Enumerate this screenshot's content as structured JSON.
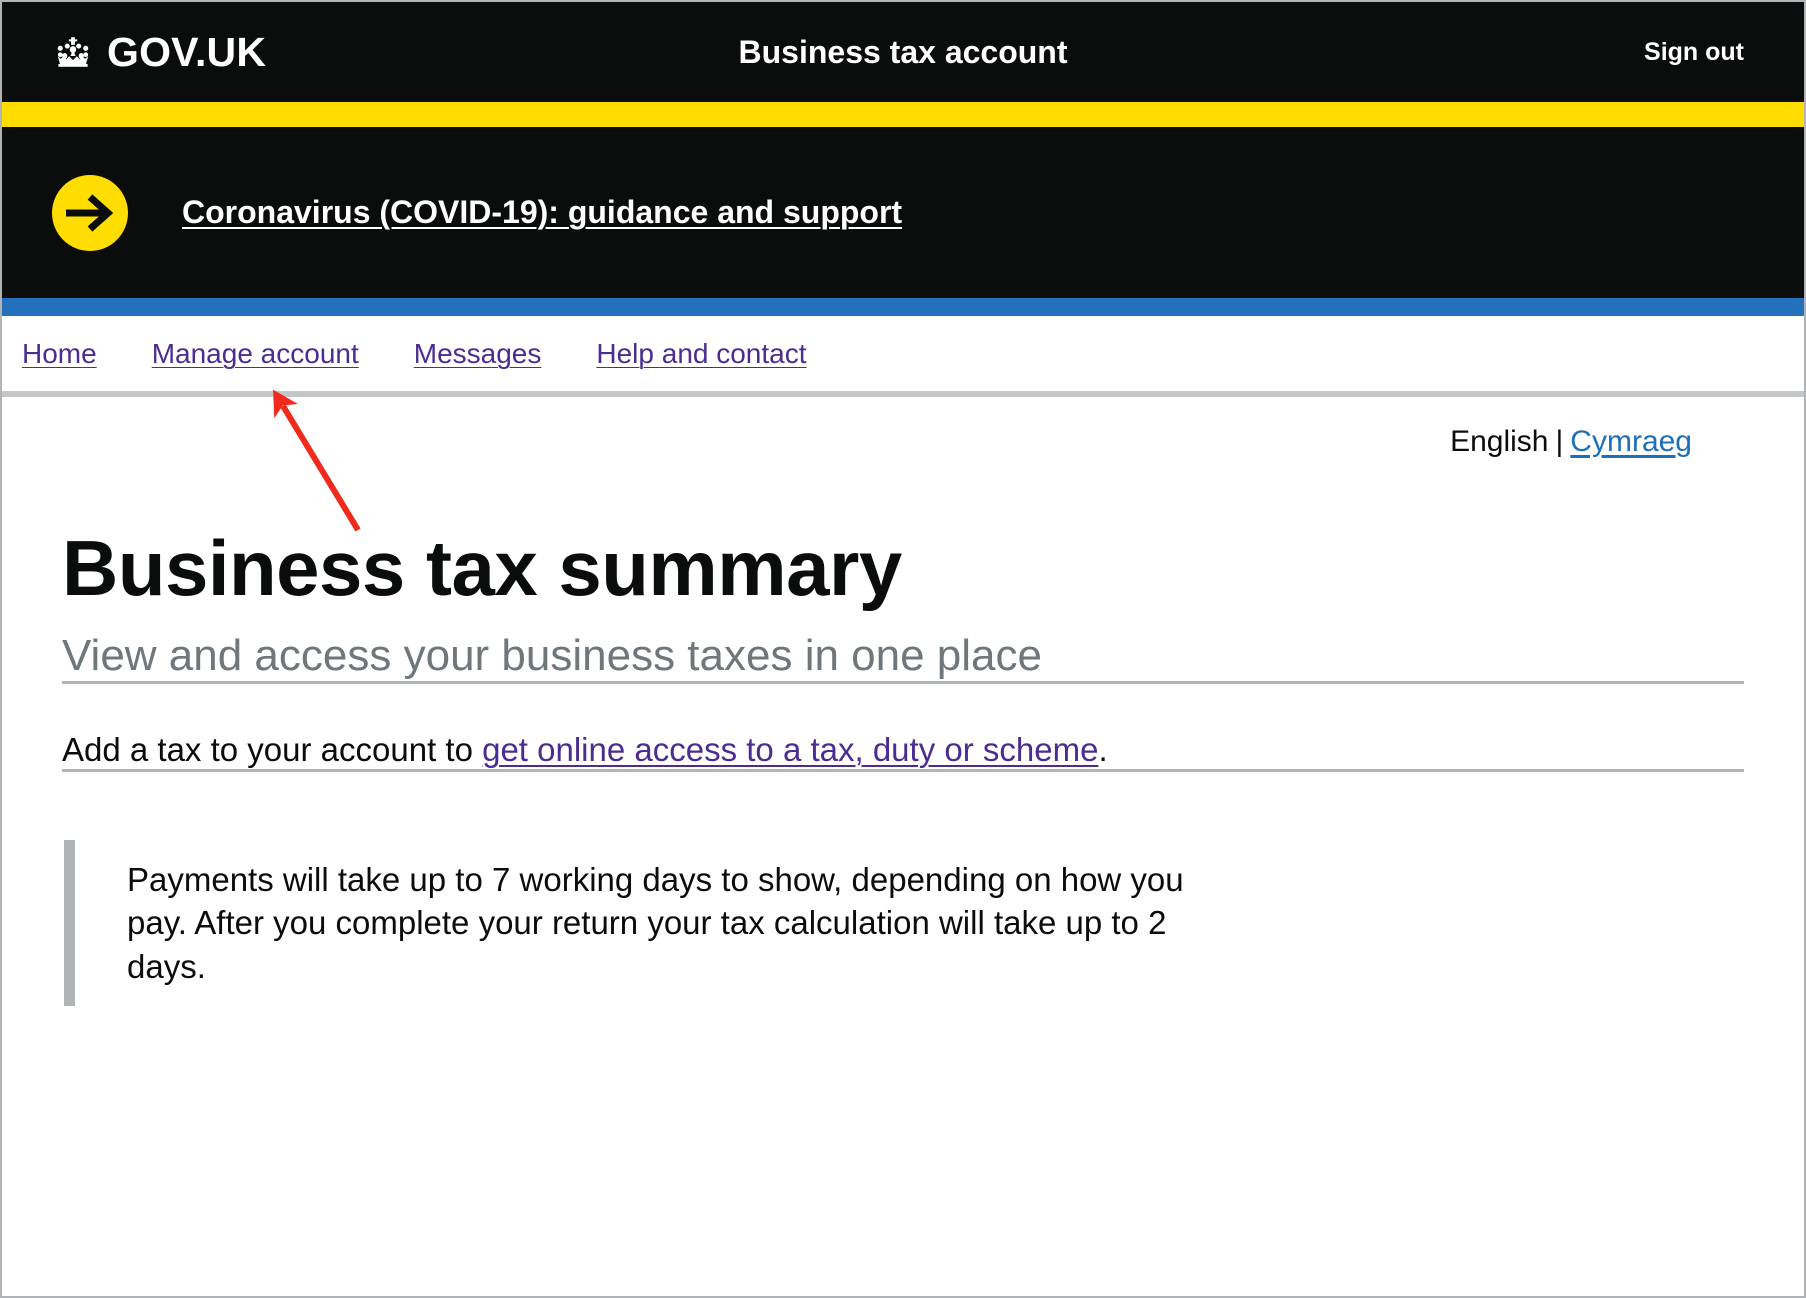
{
  "header": {
    "logo_text": "GOV.UK",
    "crown_icon": "crown-icon",
    "service_name": "Business tax account",
    "sign_out_label": "Sign out"
  },
  "covid_banner": {
    "arrow_icon": "arrow-right-circle-icon",
    "link_label": "Coronavirus (COVID-19): guidance and support"
  },
  "account_nav": {
    "items": [
      {
        "label": "Home"
      },
      {
        "label": "Manage account"
      },
      {
        "label": "Messages"
      },
      {
        "label": "Help and contact"
      }
    ]
  },
  "language": {
    "current_label": "English",
    "separator": "|",
    "alternate_label": "Cymraeg"
  },
  "main": {
    "title": "Business tax summary",
    "subtitle": "View and access your business taxes in one place",
    "add_tax_prefix": "Add a tax to your account to ",
    "add_tax_link": "get online access to a tax, duty or scheme",
    "add_tax_suffix": ".",
    "inset_text": "Payments will take up to 7 working days to show, depending on how you pay. After you complete your return your tax calculation will take up to 2 days."
  },
  "annotation": {
    "arrow_color": "#f02b1d",
    "points_at": "Manage account"
  },
  "colors": {
    "header_black": "#0b0c0c",
    "govuk_yellow": "#ffdd00",
    "nav_blue": "#2370bc",
    "link_purple": "#4c2c92",
    "link_blue": "#1d70b8",
    "grey_border": "#b1b4b6",
    "subtitle_grey": "#6f777b"
  }
}
